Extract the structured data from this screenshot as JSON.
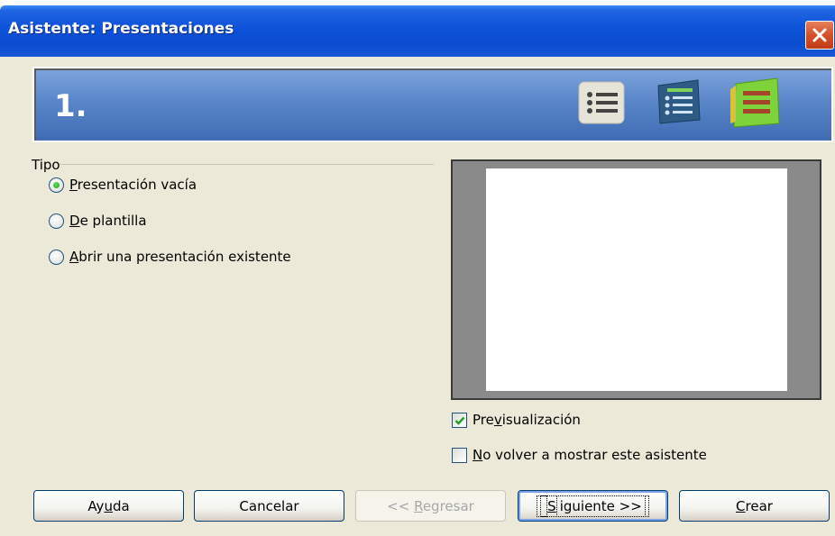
{
  "window": {
    "title": "Asistente: Presentaciones"
  },
  "banner": {
    "step": "1."
  },
  "group": {
    "label": "Tipo",
    "options": [
      {
        "pre": "",
        "key": "P",
        "post": "resentación vacía",
        "checked": true
      },
      {
        "pre": "",
        "key": "D",
        "post": "e plantilla",
        "checked": false
      },
      {
        "pre": "",
        "key": "A",
        "post": "brir una presentación existente",
        "checked": false
      }
    ]
  },
  "preview_checkbox": {
    "pre": "Pre",
    "key": "v",
    "post": "isualización",
    "checked": true
  },
  "no_show_checkbox": {
    "pre": "",
    "key": "N",
    "post": "o volver a mostrar este asistente",
    "checked": false
  },
  "buttons": {
    "help": {
      "pre": "Ay",
      "key": "u",
      "post": "da"
    },
    "cancel": {
      "pre": "Cancelar",
      "key": "",
      "post": ""
    },
    "back": {
      "pre": "<< ",
      "key": "R",
      "post": "egresar"
    },
    "next": {
      "pre": "",
      "key": "S",
      "post": "iguiente >>"
    },
    "create": {
      "pre": "",
      "key": "C",
      "post": "rear"
    }
  },
  "icons": [
    "close-icon",
    "list-light-icon",
    "list-blue-icon",
    "list-green-icon",
    "checkmark-icon"
  ],
  "colors": {
    "titlebar": "#0a4ccf",
    "banner": "#5a86c9",
    "close": "#d4502a",
    "radio_dot": "#21a121",
    "check": "#21a121"
  }
}
